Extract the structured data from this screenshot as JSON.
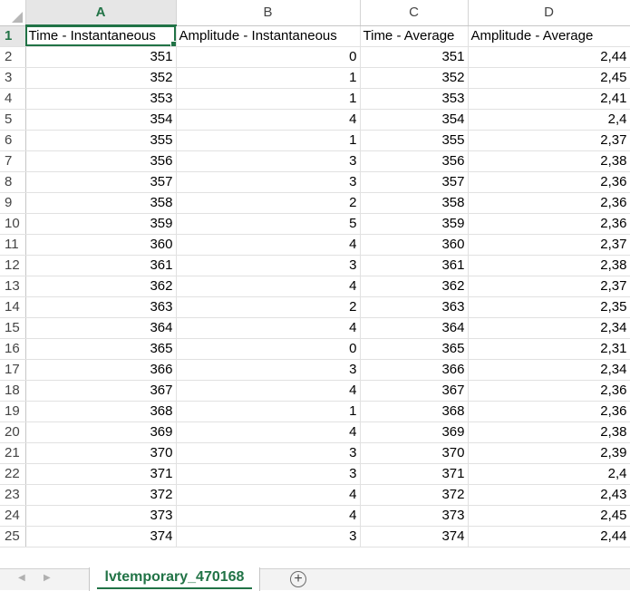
{
  "columns": [
    "A",
    "B",
    "C",
    "D"
  ],
  "headers": [
    "Time - Instantaneous",
    "Amplitude - Instantaneous",
    "Time - Average",
    "Amplitude - Average"
  ],
  "rows": [
    {
      "n": "2",
      "a": "351",
      "b": "0",
      "c": "351",
      "d": "2,44"
    },
    {
      "n": "3",
      "a": "352",
      "b": "1",
      "c": "352",
      "d": "2,45"
    },
    {
      "n": "4",
      "a": "353",
      "b": "1",
      "c": "353",
      "d": "2,41"
    },
    {
      "n": "5",
      "a": "354",
      "b": "4",
      "c": "354",
      "d": "2,4"
    },
    {
      "n": "6",
      "a": "355",
      "b": "1",
      "c": "355",
      "d": "2,37"
    },
    {
      "n": "7",
      "a": "356",
      "b": "3",
      "c": "356",
      "d": "2,38"
    },
    {
      "n": "8",
      "a": "357",
      "b": "3",
      "c": "357",
      "d": "2,36"
    },
    {
      "n": "9",
      "a": "358",
      "b": "2",
      "c": "358",
      "d": "2,36"
    },
    {
      "n": "10",
      "a": "359",
      "b": "5",
      "c": "359",
      "d": "2,36"
    },
    {
      "n": "11",
      "a": "360",
      "b": "4",
      "c": "360",
      "d": "2,37"
    },
    {
      "n": "12",
      "a": "361",
      "b": "3",
      "c": "361",
      "d": "2,38"
    },
    {
      "n": "13",
      "a": "362",
      "b": "4",
      "c": "362",
      "d": "2,37"
    },
    {
      "n": "14",
      "a": "363",
      "b": "2",
      "c": "363",
      "d": "2,35"
    },
    {
      "n": "15",
      "a": "364",
      "b": "4",
      "c": "364",
      "d": "2,34"
    },
    {
      "n": "16",
      "a": "365",
      "b": "0",
      "c": "365",
      "d": "2,31"
    },
    {
      "n": "17",
      "a": "366",
      "b": "3",
      "c": "366",
      "d": "2,34"
    },
    {
      "n": "18",
      "a": "367",
      "b": "4",
      "c": "367",
      "d": "2,36"
    },
    {
      "n": "19",
      "a": "368",
      "b": "1",
      "c": "368",
      "d": "2,36"
    },
    {
      "n": "20",
      "a": "369",
      "b": "4",
      "c": "369",
      "d": "2,38"
    },
    {
      "n": "21",
      "a": "370",
      "b": "3",
      "c": "370",
      "d": "2,39"
    },
    {
      "n": "22",
      "a": "371",
      "b": "3",
      "c": "371",
      "d": "2,4"
    },
    {
      "n": "23",
      "a": "372",
      "b": "4",
      "c": "372",
      "d": "2,43"
    },
    {
      "n": "24",
      "a": "373",
      "b": "4",
      "c": "373",
      "d": "2,45"
    },
    {
      "n": "25",
      "a": "374",
      "b": "3",
      "c": "374",
      "d": "2,44"
    }
  ],
  "sheet_tab": "lvtemporary_470168",
  "add_sheet_symbol": "+",
  "nav_left_symbol": "◀",
  "nav_right_symbol": "▶",
  "accent_color": "#217346",
  "icons": {
    "add_sheet": "plus-circle-icon",
    "nav_left": "chevron-left-icon",
    "nav_right": "chevron-right-icon",
    "select_all": "select-all-triangle-icon"
  }
}
